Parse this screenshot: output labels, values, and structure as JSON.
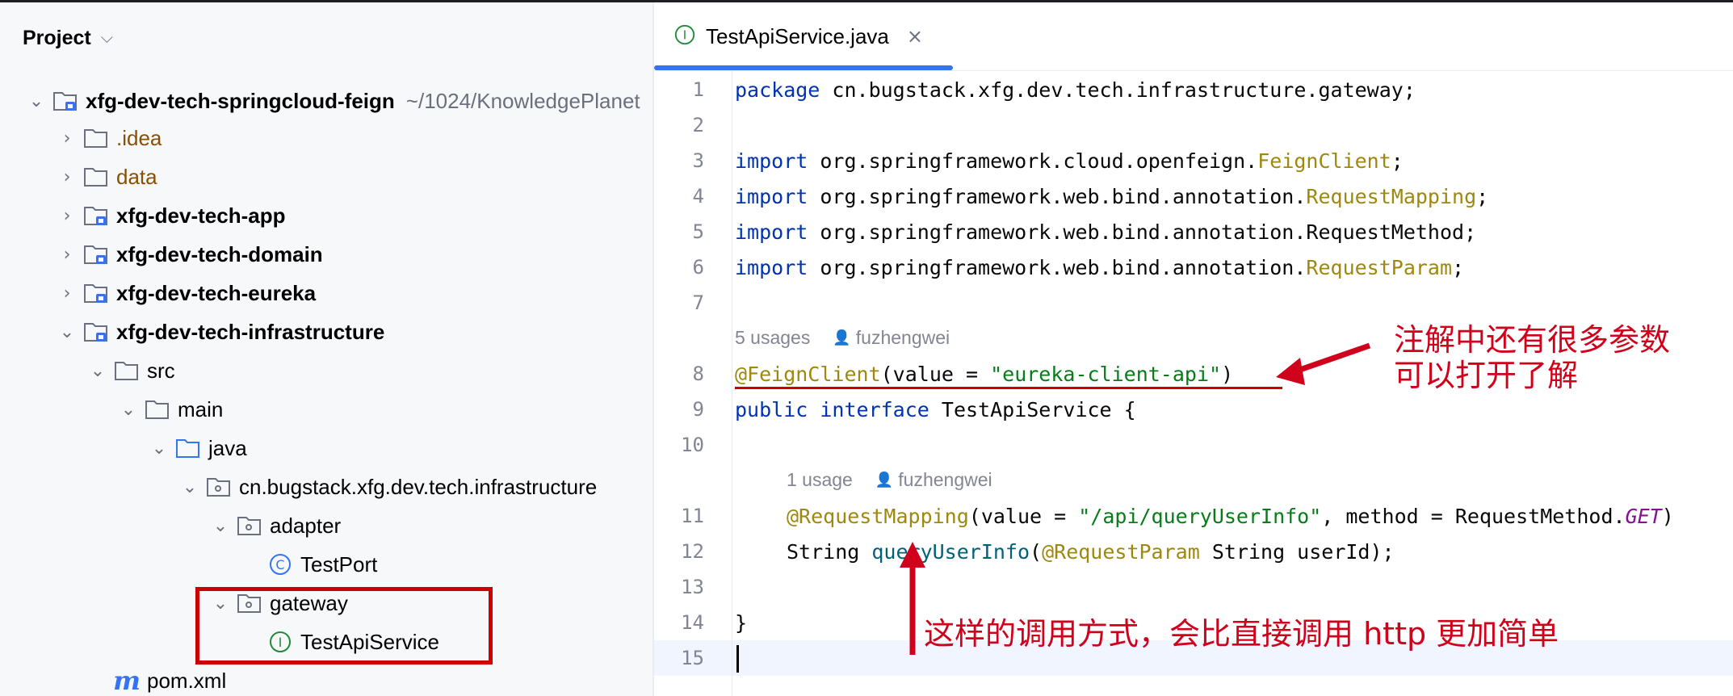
{
  "project_panel": {
    "title": "Project",
    "tree": [
      {
        "label": "xfg-dev-tech-springcloud-feign",
        "path": "~/1024/KnowledgePlanet",
        "expanded": true,
        "icon": "module-folder-icon"
      },
      {
        "label": ".idea",
        "expanded": false,
        "icon": "folder-icon"
      },
      {
        "label": "data",
        "expanded": false,
        "icon": "folder-icon"
      },
      {
        "label": "xfg-dev-tech-app",
        "expanded": false,
        "icon": "module-folder-icon"
      },
      {
        "label": "xfg-dev-tech-domain",
        "expanded": false,
        "icon": "module-folder-icon"
      },
      {
        "label": "xfg-dev-tech-eureka",
        "expanded": false,
        "icon": "module-folder-icon"
      },
      {
        "label": "xfg-dev-tech-infrastructure",
        "expanded": true,
        "icon": "module-folder-icon"
      },
      {
        "label": "src",
        "expanded": true,
        "icon": "folder-icon"
      },
      {
        "label": "main",
        "expanded": true,
        "icon": "folder-icon"
      },
      {
        "label": "java",
        "expanded": true,
        "icon": "source-folder-icon"
      },
      {
        "label": "cn.bugstack.xfg.dev.tech.infrastructure",
        "expanded": true,
        "icon": "package-icon"
      },
      {
        "label": "adapter",
        "expanded": true,
        "icon": "package-icon"
      },
      {
        "label": "TestPort",
        "icon": "class-icon"
      },
      {
        "label": "gateway",
        "expanded": true,
        "icon": "package-icon"
      },
      {
        "label": "TestApiService",
        "icon": "interface-icon"
      },
      {
        "label": "pom.xml",
        "icon": "maven-icon"
      }
    ]
  },
  "editor": {
    "tab": {
      "label": "TestApiService.java",
      "close": "×"
    },
    "line_numbers": [
      "1",
      "2",
      "3",
      "4",
      "5",
      "6",
      "7",
      "8",
      "9",
      "10",
      "11",
      "12",
      "13",
      "14",
      "15"
    ],
    "code": {
      "l1": {
        "kw": "package",
        "rest": " cn.bugstack.xfg.dev.tech.infrastructure.gateway;"
      },
      "l3": {
        "kw": "import",
        "pre": " org.springframework.cloud.openfeign.",
        "cls": "FeignClient",
        "post": ";"
      },
      "l4": {
        "kw": "import",
        "pre": " org.springframework.web.bind.annotation.",
        "cls": "RequestMapping",
        "post": ";"
      },
      "l5": {
        "kw": "import",
        "pre": " org.springframework.web.bind.annotation.RequestMethod;"
      },
      "l6": {
        "kw": "import",
        "pre": " org.springframework.web.bind.annotation.",
        "cls": "RequestParam",
        "post": ";"
      },
      "l8": {
        "ann": "@FeignClient",
        "p1": "(value = ",
        "str": "\"eureka-client-api\"",
        "p2": ")"
      },
      "l9": {
        "kw1": "public",
        "kw2": "interface",
        "rest": " TestApiService {"
      },
      "l11": {
        "ann": "@RequestMapping",
        "p1": "(value = ",
        "str": "\"/api/queryUserInfo\"",
        "p2": ", method = RequestMethod.",
        "const": "GET",
        "p3": ")"
      },
      "l12": {
        "p1": "String ",
        "meth": "queryUserInfo",
        "p2": "(",
        "ann": "@RequestParam",
        "p3": " String userId);"
      },
      "l14": {
        "rest": "}"
      }
    },
    "inlays": {
      "first": {
        "usages": "5 usages",
        "author": "fuzhengwei"
      },
      "second": {
        "usages": "1 usage",
        "author": "fuzhengwei"
      }
    }
  },
  "annotations": {
    "note1_line1": "注解中还有很多参数",
    "note1_line2": "可以打开了解",
    "note2": "这样的调用方式，会比直接调用 http 更加简单",
    "color": "#d0021b"
  }
}
